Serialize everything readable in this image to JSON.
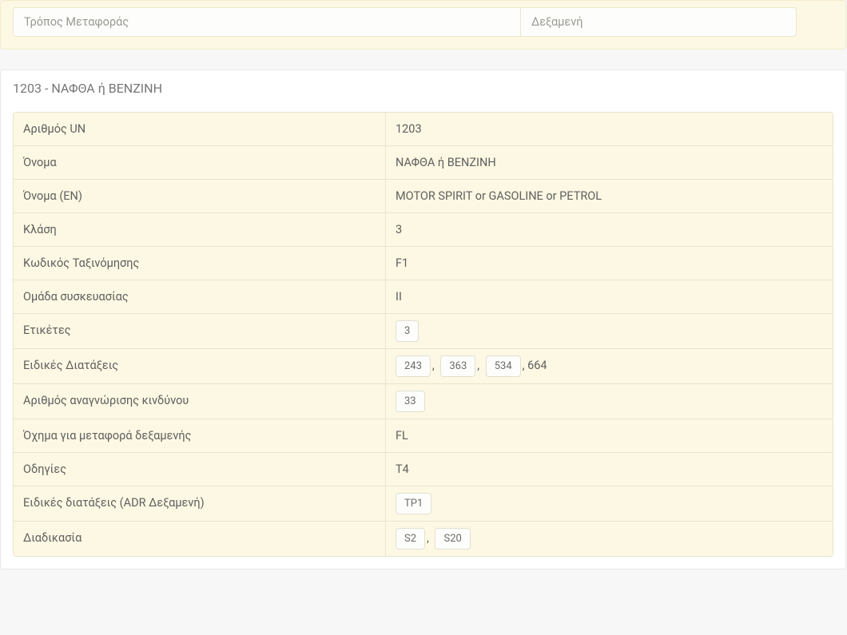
{
  "top": {
    "transport_label": "Τρόπος Μεταφοράς",
    "transport_value": "Δεξαμενή"
  },
  "title": "1203 - ΝΑΦΘΑ ή BENZINH",
  "rows": [
    {
      "label": "Αριθμός UN",
      "type": "text",
      "value": "1203"
    },
    {
      "label": "Όνομα",
      "type": "text",
      "value": "ΝΑΦΘΑ ή BENZINH"
    },
    {
      "label": "Όνομα (EN)",
      "type": "text",
      "value": "MOTOR SPIRIT or GASOLINE or PETROL"
    },
    {
      "label": "Κλάση",
      "type": "text",
      "value": "3"
    },
    {
      "label": "Κωδικός Ταξινόμησης",
      "type": "text",
      "value": "F1"
    },
    {
      "label": "Ομάδα συσκευασίας",
      "type": "text",
      "value": "II"
    },
    {
      "label": "Ετικέτες",
      "type": "badges",
      "items": [
        {
          "badge": "3"
        }
      ]
    },
    {
      "label": "Ειδικές Διατάξεις",
      "type": "badges",
      "items": [
        {
          "badge": "243"
        },
        {
          "sep": ", "
        },
        {
          "badge": "363"
        },
        {
          "sep": ", "
        },
        {
          "badge": "534"
        },
        {
          "plain": ", 664"
        }
      ]
    },
    {
      "label": "Αριθμός αναγνώρισης κινδύνου",
      "type": "badges",
      "items": [
        {
          "badge": "33"
        }
      ]
    },
    {
      "label": "Όχημα για μεταφορά δεξαμενής",
      "type": "text",
      "value": "FL"
    },
    {
      "label": "Οδηγίες",
      "type": "text",
      "value": "T4"
    },
    {
      "label": "Ειδικές διατάξεις (ADR Δεξαμενή)",
      "type": "badges",
      "items": [
        {
          "badge": "TP1"
        }
      ]
    },
    {
      "label": "Διαδικασία",
      "type": "badges",
      "items": [
        {
          "badge": "S2"
        },
        {
          "sep": ", "
        },
        {
          "badge": "S20"
        }
      ]
    }
  ]
}
